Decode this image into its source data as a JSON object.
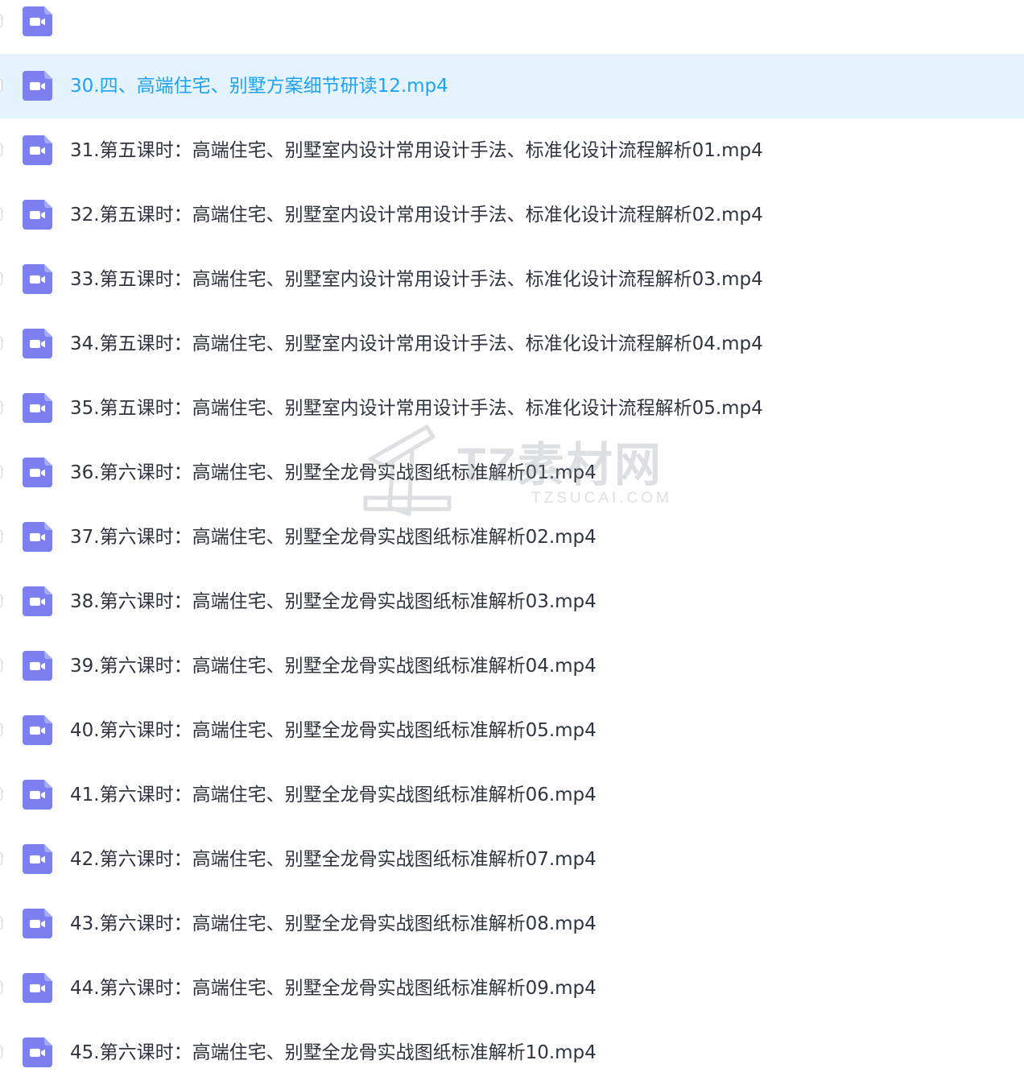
{
  "files": [
    {
      "name": "",
      "icon": "video-file-icon",
      "selected": false
    },
    {
      "name": "30.四、高端住宅、别墅方案细节研读12.mp4",
      "icon": "video-file-icon",
      "selected": true
    },
    {
      "name": "31.第五课时：高端住宅、别墅室内设计常用设计手法、标准化设计流程解析01.mp4",
      "icon": "video-file-icon",
      "selected": false
    },
    {
      "name": "32.第五课时：高端住宅、别墅室内设计常用设计手法、标准化设计流程解析02.mp4",
      "icon": "video-file-icon",
      "selected": false
    },
    {
      "name": "33.第五课时：高端住宅、别墅室内设计常用设计手法、标准化设计流程解析03.mp4",
      "icon": "video-file-icon",
      "selected": false
    },
    {
      "name": "34.第五课时：高端住宅、别墅室内设计常用设计手法、标准化设计流程解析04.mp4",
      "icon": "video-file-icon",
      "selected": false
    },
    {
      "name": "35.第五课时：高端住宅、别墅室内设计常用设计手法、标准化设计流程解析05.mp4",
      "icon": "video-file-icon",
      "selected": false
    },
    {
      "name": "36.第六课时：高端住宅、别墅全龙骨实战图纸标准解析01.mp4",
      "icon": "video-file-icon",
      "selected": false
    },
    {
      "name": "37.第六课时：高端住宅、别墅全龙骨实战图纸标准解析02.mp4",
      "icon": "video-file-icon",
      "selected": false
    },
    {
      "name": "38.第六课时：高端住宅、别墅全龙骨实战图纸标准解析03.mp4",
      "icon": "video-file-icon",
      "selected": false
    },
    {
      "name": "39.第六课时：高端住宅、别墅全龙骨实战图纸标准解析04.mp4",
      "icon": "video-file-icon",
      "selected": false
    },
    {
      "name": "40.第六课时：高端住宅、别墅全龙骨实战图纸标准解析05.mp4",
      "icon": "video-file-icon",
      "selected": false
    },
    {
      "name": "41.第六课时：高端住宅、别墅全龙骨实战图纸标准解析06.mp4",
      "icon": "video-file-icon",
      "selected": false
    },
    {
      "name": "42.第六课时：高端住宅、别墅全龙骨实战图纸标准解析07.mp4",
      "icon": "video-file-icon",
      "selected": false
    },
    {
      "name": "43.第六课时：高端住宅、别墅全龙骨实战图纸标准解析08.mp4",
      "icon": "video-file-icon",
      "selected": false
    },
    {
      "name": "44.第六课时：高端住宅、别墅全龙骨实战图纸标准解析09.mp4",
      "icon": "video-file-icon",
      "selected": false
    },
    {
      "name": "45.第六课时：高端住宅、别墅全龙骨实战图纸标准解析10.mp4",
      "icon": "video-file-icon",
      "selected": false
    }
  ],
  "colors": {
    "icon": "#7b7ff0",
    "selected_bg": "#e5f3ff",
    "selected_text": "#20a3f5",
    "text": "#2f3441"
  },
  "watermark": {
    "brand": "TZ素材网",
    "url": "TZSUCAI.COM"
  }
}
